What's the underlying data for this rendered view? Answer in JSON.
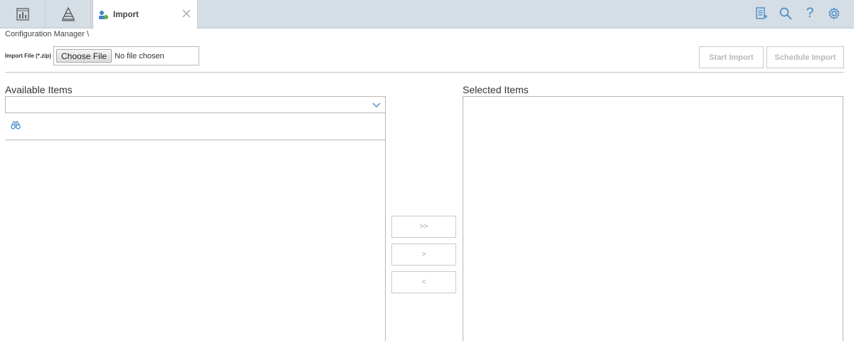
{
  "tabs": {
    "active": {
      "label": "Import",
      "icon": "import-tool-icon"
    },
    "icons": [
      "dashboard-icon",
      "pyramid-icon"
    ]
  },
  "top_actions": [
    "new-list-icon",
    "search-icon",
    "help-icon",
    "gear-icon"
  ],
  "top_actions_glyphs": {
    "help": "?"
  },
  "breadcrumb": "Configuration Manager \\",
  "import_file": {
    "label": "Import File (*.zip)",
    "choose_button": "Choose File",
    "status": "No file chosen"
  },
  "actions": {
    "start_import": "Start Import",
    "schedule_import": "Schedule Import"
  },
  "available": {
    "title": "Available Items"
  },
  "selected": {
    "title": "Selected Items"
  },
  "move_buttons": {
    "add_all": ">>",
    "add": ">",
    "remove": "<"
  },
  "colors": {
    "accent": "#3d86c6",
    "topbar": "#d5dde5"
  }
}
